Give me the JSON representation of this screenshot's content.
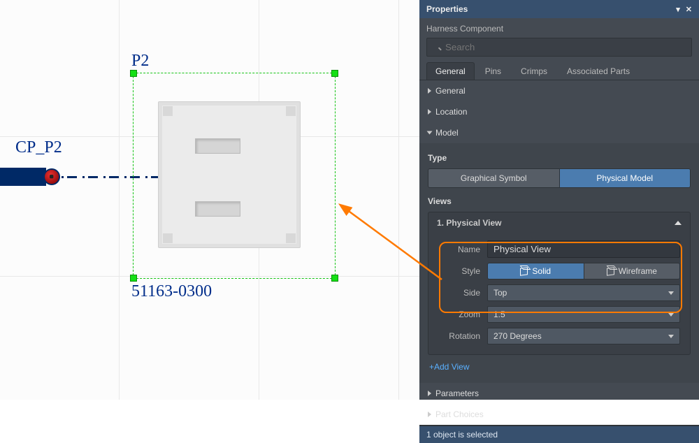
{
  "canvas": {
    "designator": "P2",
    "connection_point": "CP_P2",
    "part_number": "51163-0300"
  },
  "panel": {
    "title": "Properties",
    "subtitle": "Harness Component",
    "search_placeholder": "Search",
    "tabs": [
      "General",
      "Pins",
      "Crimps",
      "Associated Parts"
    ],
    "sections": {
      "general": "General",
      "location": "Location",
      "model": "Model",
      "parameters": "Parameters",
      "part_choices": "Part Choices"
    },
    "model": {
      "type_label": "Type",
      "type_options": {
        "graphical": "Graphical Symbol",
        "physical": "Physical Model"
      },
      "views_label": "Views",
      "view1": {
        "heading": "1. Physical View",
        "name_label": "Name",
        "name_value": "Physical View",
        "style_label": "Style",
        "style_solid": "Solid",
        "style_wireframe": "Wireframe",
        "side_label": "Side",
        "side_value": "Top",
        "zoom_label": "Zoom",
        "zoom_value": "1.5",
        "rotation_label": "Rotation",
        "rotation_value": "270 Degrees"
      },
      "add_view": "+Add View"
    },
    "status": "1 object is selected"
  }
}
